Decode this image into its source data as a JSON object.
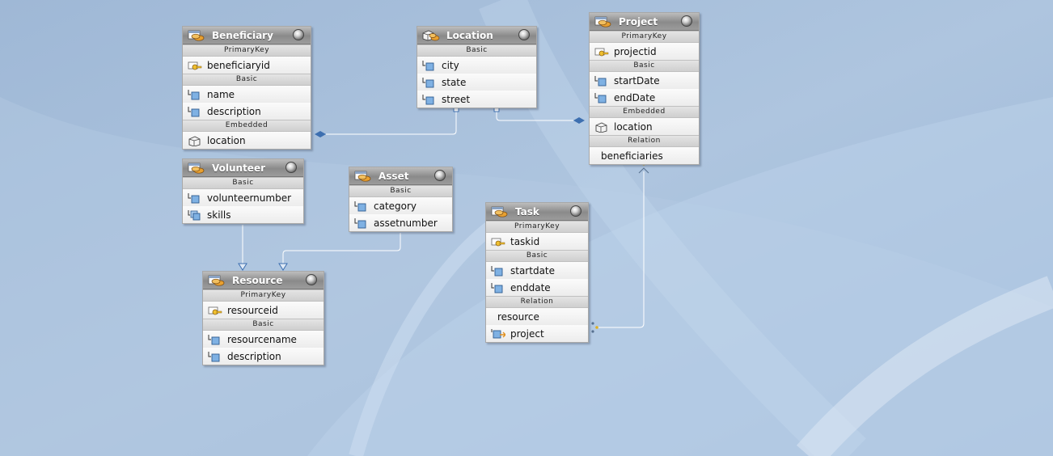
{
  "entities": {
    "beneficiary": {
      "title": "Beneficiary",
      "s1": "PrimaryKey",
      "f1": "beneficiaryid",
      "s2": "Basic",
      "f2": "name",
      "f3": "description",
      "s3": "Embedded",
      "f4": "location"
    },
    "location": {
      "title": "Location",
      "s1": "Basic",
      "f1": "city",
      "f2": "state",
      "f3": "street"
    },
    "project": {
      "title": "Project",
      "s1": "PrimaryKey",
      "f1": "projectid",
      "s2": "Basic",
      "f2": "startDate",
      "f3": "endDate",
      "s3": "Embedded",
      "f4": "location",
      "s4": "Relation",
      "f5": "beneficiaries"
    },
    "volunteer": {
      "title": "Volunteer",
      "s1": "Basic",
      "f1": "volunteernumber",
      "f2": "skills"
    },
    "asset": {
      "title": "Asset",
      "s1": "Basic",
      "f1": "category",
      "f2": "assetnumber"
    },
    "task": {
      "title": "Task",
      "s1": "PrimaryKey",
      "f1": "taskid",
      "s2": "Basic",
      "f2": "startdate",
      "f3": "enddate",
      "s3": "Relation",
      "f4": "resource",
      "f5": "project"
    },
    "resource": {
      "title": "Resource",
      "s1": "PrimaryKey",
      "f1": "resourceid",
      "s2": "Basic",
      "f2": "resourcename",
      "f3": "description"
    }
  },
  "icons": {
    "entity": "entity-icon",
    "key": "key-icon",
    "basic": "basic-field-icon",
    "collection": "collection-field-icon",
    "embedded": "embedded-icon",
    "embeddable": "embeddable-icon",
    "relation": "relation-field-icon"
  },
  "colors": {
    "background": "#a9c1dc",
    "connector": "#ffffff",
    "diamond": "#3d6fb0"
  }
}
